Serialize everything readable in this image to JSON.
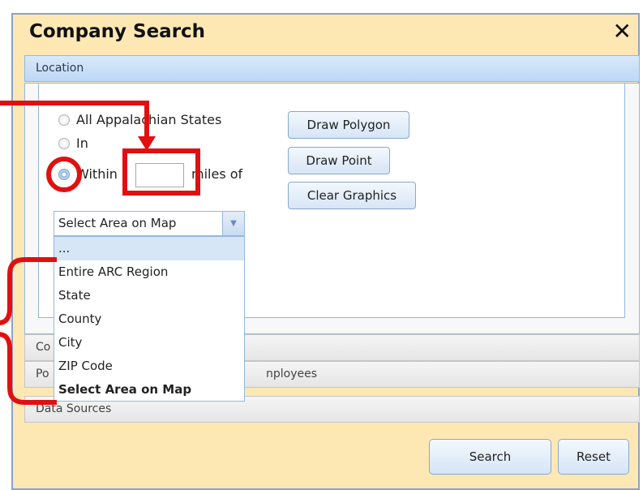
{
  "dialog": {
    "title": "Company Search",
    "close_label": "✕"
  },
  "panels": {
    "location_label": "Location",
    "company_partial": "Co",
    "population_partial_left": "Po",
    "population_partial_right": "nployees",
    "data_sources_label": "Data Sources"
  },
  "location": {
    "radio_all": "All Appalachian States",
    "radio_in": "In",
    "radio_within": "Within",
    "miles_of": "miles of",
    "miles_value": "",
    "selected_area": "Select Area on Map",
    "buttons": {
      "draw_polygon": "Draw Polygon",
      "draw_point": "Draw Point",
      "clear_graphics": "Clear Graphics"
    }
  },
  "dropdown": {
    "options": [
      "...",
      "Entire ARC Region",
      "State",
      "County",
      "City",
      "ZIP Code",
      "Select Area on Map"
    ]
  },
  "footer": {
    "search_label": "Search",
    "reset_label": "Reset"
  },
  "colors": {
    "dialog_bg": "#fde8b4",
    "panel_active": "#bdd8f5",
    "annotation": "#e01010"
  }
}
